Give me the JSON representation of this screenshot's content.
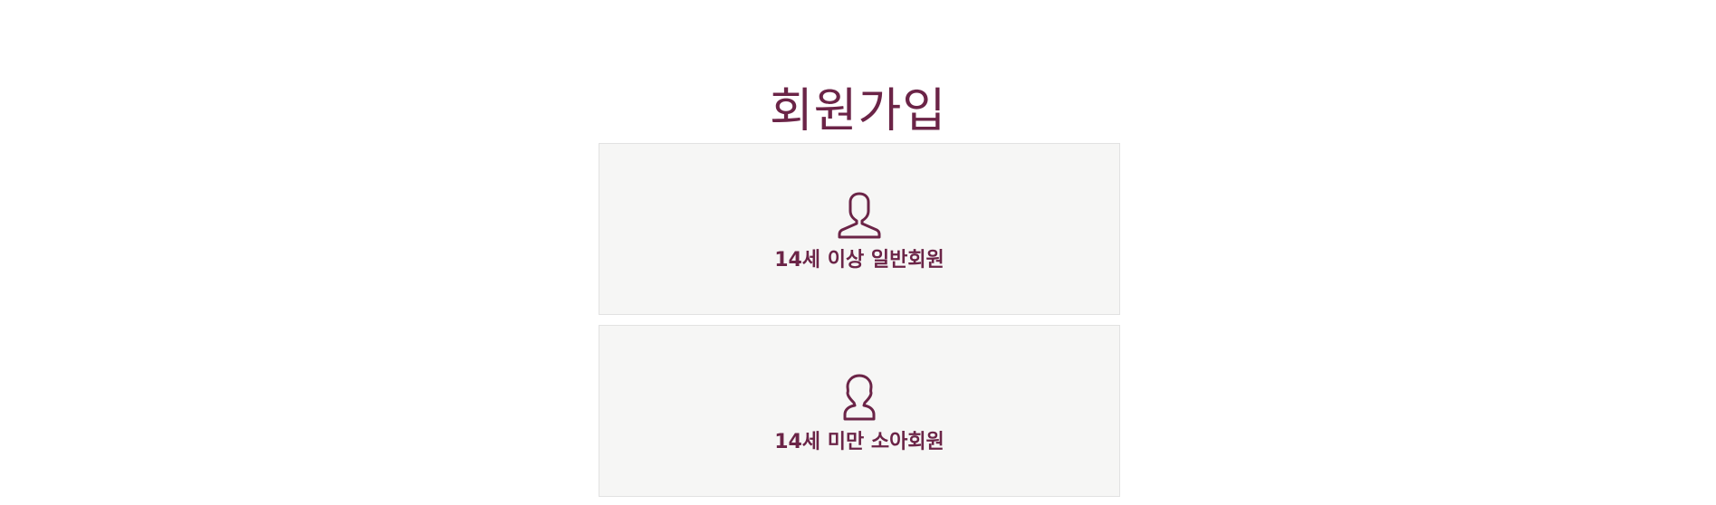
{
  "page": {
    "title": "회원가입"
  },
  "options": [
    {
      "label": "14세 이상 일반회원",
      "icon": "adult-user-icon"
    },
    {
      "label": "14세 미만 소아회원",
      "icon": "child-user-icon"
    }
  ],
  "colors": {
    "accent": "#6b2447",
    "card_background": "#f6f6f5",
    "card_border": "#e2e2e2"
  }
}
